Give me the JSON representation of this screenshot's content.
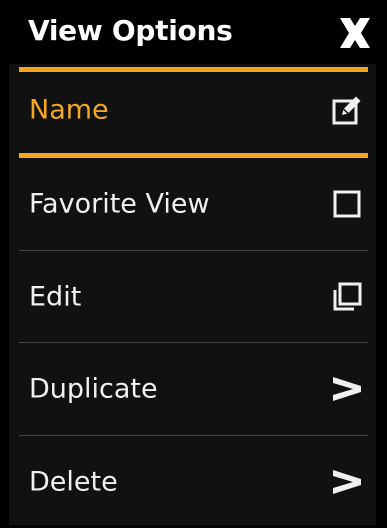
{
  "window": {
    "title": "View Options",
    "close_icon": "close-icon"
  },
  "menu": {
    "items": [
      {
        "label": "Name",
        "icon": "edit-icon",
        "selected": true
      },
      {
        "label": "Favorite View",
        "icon": "checkbox-icon",
        "checked": false
      },
      {
        "label": "Edit",
        "icon": "windows-icon"
      },
      {
        "label": "Duplicate",
        "icon": "chevron-right-icon"
      },
      {
        "label": "Delete",
        "icon": "chevron-right-icon"
      }
    ]
  },
  "colors": {
    "accent": "#f2a71e",
    "background": "#000000",
    "panel": "#111111",
    "text": "#f0f0f0"
  }
}
